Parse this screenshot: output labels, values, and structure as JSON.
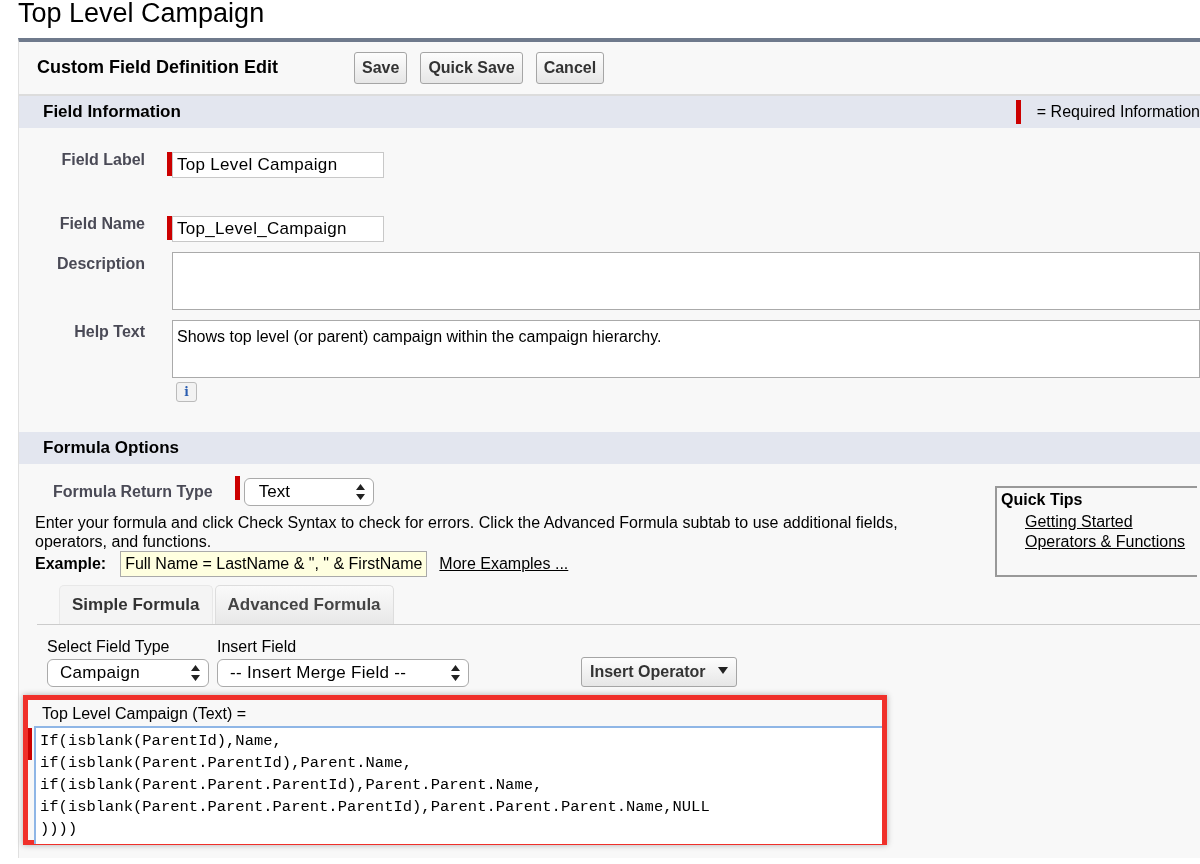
{
  "page_title": "Top Level Campaign",
  "edit_panel": {
    "title": "Custom Field Definition Edit",
    "buttons": [
      "Save",
      "Quick Save",
      "Cancel"
    ]
  },
  "field_information": {
    "heading": "Field Information",
    "required_legend": "= Required Information",
    "fields": [
      {
        "label": "Field Label",
        "kind": "text",
        "required": true,
        "value": "Top Level Campaign"
      },
      {
        "label": "Field Name",
        "kind": "text",
        "required": true,
        "value": "Top_Level_Campaign"
      },
      {
        "label": "Description",
        "kind": "textarea",
        "required": false
      },
      {
        "label": "Help Text",
        "kind": "textarea",
        "required": false,
        "value": "Shows top level (or parent) campaign within the campaign hierarchy.",
        "info_icon": "i"
      }
    ]
  },
  "formula_options": {
    "heading": "Formula Options",
    "return_type": {
      "label": "Formula Return Type",
      "value": "Text",
      "required": true
    },
    "instructions": "Enter your formula and click Check Syntax to check for errors. Click the Advanced Formula subtab to use additional fields, operators, and functions.",
    "example": {
      "label": "Example:",
      "value": "Full Name = LastName & \", \" & FirstName",
      "link": "More Examples ..."
    },
    "quick_tips": {
      "title": "Quick Tips",
      "links": [
        "Getting Started",
        "Operators & Functions"
      ]
    },
    "tabs": [
      {
        "label": "Simple Formula",
        "selected": true
      },
      {
        "label": "Advanced Formula",
        "selected": false
      }
    ],
    "selectors": [
      {
        "label": "Select Field Type",
        "value": "Campaign"
      },
      {
        "label": "Insert Field",
        "value": "-- Insert Merge Field --"
      }
    ],
    "insert_operator": "Insert Operator",
    "formula": {
      "label": "Top Level Campaign (Text) =",
      "required": true,
      "highlighted": true,
      "value": "If(isblank(ParentId),Name,\nif(isblank(Parent.ParentId),Parent.Name,\nif(isblank(Parent.Parent.ParentId),Parent.Parent.Name,\nif(isblank(Parent.Parent.Parent.ParentId),Parent.Parent.Parent.Name,NULL\n))))"
    }
  }
}
